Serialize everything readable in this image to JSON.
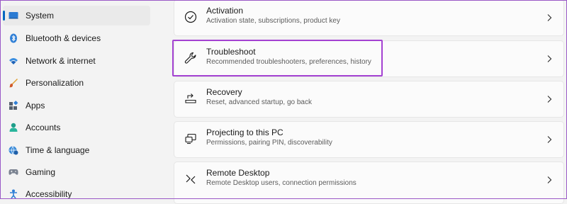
{
  "sidebar": {
    "items": [
      {
        "label": "System",
        "icon": "system-display-icon",
        "selected": true
      },
      {
        "label": "Bluetooth & devices",
        "icon": "bluetooth-icon"
      },
      {
        "label": "Network & internet",
        "icon": "wifi-icon"
      },
      {
        "label": "Personalization",
        "icon": "brush-icon"
      },
      {
        "label": "Apps",
        "icon": "apps-icon"
      },
      {
        "label": "Accounts",
        "icon": "accounts-icon"
      },
      {
        "label": "Time & language",
        "icon": "globe-clock-icon"
      },
      {
        "label": "Gaming",
        "icon": "gamepad-icon"
      },
      {
        "label": "Accessibility",
        "icon": "accessibility-icon"
      }
    ]
  },
  "main": {
    "cards": [
      {
        "title": "Activation",
        "subtitle": "Activation state, subscriptions, product key",
        "icon": "check-circle-icon"
      },
      {
        "title": "Troubleshoot",
        "subtitle": "Recommended troubleshooters, preferences, history",
        "icon": "wrench-icon",
        "highlighted": true
      },
      {
        "title": "Recovery",
        "subtitle": "Reset, advanced startup, go back",
        "icon": "recovery-icon"
      },
      {
        "title": "Projecting to this PC",
        "subtitle": "Permissions, pairing PIN, discoverability",
        "icon": "projecting-icon"
      },
      {
        "title": "Remote Desktop",
        "subtitle": "Remote Desktop users, connection permissions",
        "icon": "remote-desktop-icon"
      }
    ]
  },
  "colors": {
    "accent": "#0067c0",
    "highlight_box": "#a442d2",
    "frame": "#9a59c7"
  }
}
